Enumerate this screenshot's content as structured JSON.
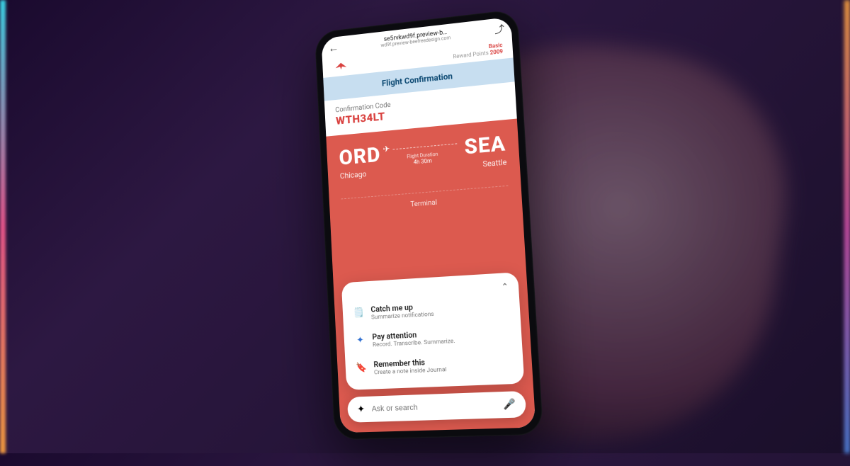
{
  "browser": {
    "url_main": "se5rvkwd9f.preview-b…",
    "url_sub": "wd9f.preview-beefreedesign.com"
  },
  "header": {
    "tier": "Basic",
    "reward_label": "Reward Points",
    "reward_value": "2009"
  },
  "banner": {
    "title": "Flight Confirmation"
  },
  "confirmation": {
    "label": "Confirmation Code",
    "code": "WTH34LT"
  },
  "flight": {
    "origin_code": "ORD",
    "origin_city": "Chicago",
    "dest_code": "SEA",
    "dest_city": "Seattle",
    "duration_label": "Flight Duration",
    "duration_value": "4h 30m",
    "terminal_label": "Terminal"
  },
  "assistant": {
    "suggestions": [
      {
        "icon": "document-icon",
        "title": "Catch me up",
        "subtitle": "Summarize notifications"
      },
      {
        "icon": "sparkle-icon",
        "title": "Pay attention",
        "subtitle": "Record. Transcribe. Summarize."
      },
      {
        "icon": "bookmark-icon",
        "title": "Remember this",
        "subtitle": "Create a note inside Journal"
      }
    ],
    "search_placeholder": "Ask or search"
  },
  "icon_glyphs": {
    "document-icon": "🗒️",
    "sparkle-icon": "✦",
    "bookmark-icon": "🔖"
  },
  "colors": {
    "brand_red": "#d9413f",
    "card_red": "#dc5a4f",
    "banner_bg": "#c7def0",
    "banner_fg": "#0d4a73"
  }
}
